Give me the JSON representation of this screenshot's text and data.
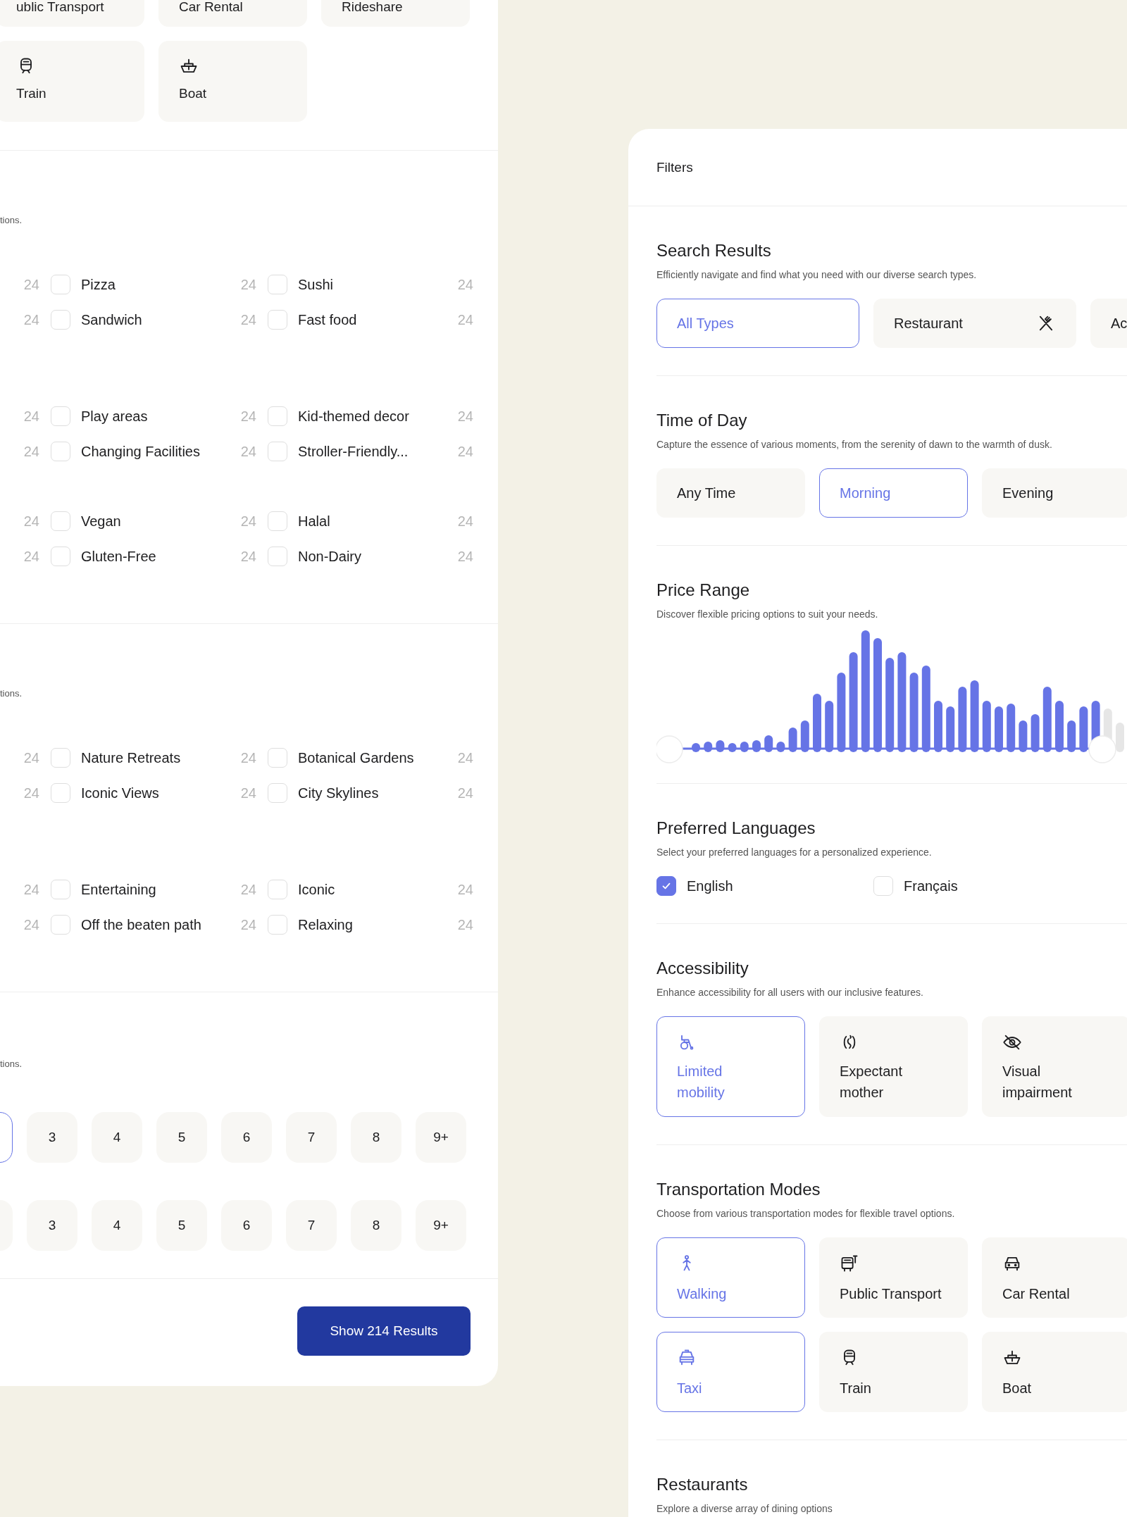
{
  "left_panel": {
    "transport_rows": [
      {
        "cards": [
          {
            "label": "ublic Transport"
          },
          {
            "label": "Car Rental"
          },
          {
            "label": "Rideshare"
          }
        ]
      },
      {
        "cards": [
          {
            "label": "Train"
          },
          {
            "label": "Boat"
          }
        ]
      }
    ],
    "option_sections": [
      {
        "description": "tions.",
        "groups": [
          {
            "rows": [
              [
                {
                  "count": "24"
                },
                {
                  "label": "Pizza",
                  "checked": false,
                  "count": "24"
                },
                {
                  "label": "Sushi",
                  "checked": false,
                  "count": "24"
                }
              ],
              [
                {
                  "count": "24"
                },
                {
                  "label": "Sandwich",
                  "checked": false,
                  "count": "24"
                },
                {
                  "label": "Fast food",
                  "checked": false,
                  "count": "24"
                }
              ]
            ]
          },
          {
            "rows": [
              [
                {
                  "count": "24"
                },
                {
                  "label": "Play areas",
                  "checked": false,
                  "count": "24"
                },
                {
                  "label": "Kid-themed decor",
                  "checked": false,
                  "count": "24"
                }
              ],
              [
                {
                  "count": "24"
                },
                {
                  "label": "Changing Facilities",
                  "checked": false,
                  "count": "24"
                },
                {
                  "label": "Stroller-Friendly...",
                  "checked": false,
                  "count": "24"
                }
              ]
            ]
          },
          {
            "rows": [
              [
                {
                  "count": "24"
                },
                {
                  "label": "Vegan",
                  "checked": false,
                  "count": "24"
                },
                {
                  "label": "Halal",
                  "checked": false,
                  "count": "24"
                }
              ],
              [
                {
                  "count": "24"
                },
                {
                  "label": "Gluten-Free",
                  "checked": false,
                  "count": "24"
                },
                {
                  "label": "Non-Dairy",
                  "checked": false,
                  "count": "24"
                }
              ]
            ]
          }
        ]
      },
      {
        "description": "tions.",
        "groups": [
          {
            "rows": [
              [
                {
                  "count": "24"
                },
                {
                  "label": "Nature Retreats",
                  "checked": false,
                  "count": "24"
                },
                {
                  "label": "Botanical Gardens",
                  "checked": false,
                  "count": "24"
                }
              ],
              [
                {
                  "count": "24"
                },
                {
                  "label": "Iconic Views",
                  "checked": false,
                  "count": "24"
                },
                {
                  "label": "City Skylines",
                  "checked": false,
                  "count": "24"
                }
              ]
            ]
          },
          {
            "rows": [
              [
                {
                  "count": "24"
                },
                {
                  "label": "Entertaining",
                  "checked": false,
                  "count": "24"
                },
                {
                  "label": "Iconic",
                  "checked": false,
                  "count": "24"
                }
              ],
              [
                {
                  "count": "24"
                },
                {
                  "label": "Off the beaten path",
                  "checked": false,
                  "count": "24"
                },
                {
                  "label": "Relaxing",
                  "checked": false,
                  "count": "24"
                }
              ]
            ]
          }
        ]
      }
    ],
    "number_section": {
      "description": "tions.",
      "rows": [
        {
          "buttons": [
            {
              "selected": true
            },
            {
              "label": "3",
              "selected": false
            },
            {
              "label": "4",
              "selected": false
            },
            {
              "label": "5",
              "selected": false
            },
            {
              "label": "6",
              "selected": false
            },
            {
              "label": "7",
              "selected": false
            },
            {
              "label": "8",
              "selected": false
            },
            {
              "label": "9+",
              "selected": false
            }
          ]
        },
        {
          "buttons": [
            {
              "selected": false
            },
            {
              "label": "3",
              "selected": false
            },
            {
              "label": "4",
              "selected": false
            },
            {
              "label": "5",
              "selected": false
            },
            {
              "label": "6",
              "selected": false
            },
            {
              "label": "7",
              "selected": false
            },
            {
              "label": "8",
              "selected": false
            },
            {
              "label": "9+",
              "selected": false
            }
          ]
        }
      ]
    },
    "show_button": "Show 214 Results"
  },
  "right_panel": {
    "title": "Filters",
    "sections": [
      {
        "kind": "choices",
        "title": "Search Results",
        "description": "Efficiently navigate and find what you need with our diverse search types.",
        "options": [
          {
            "label": "All Types",
            "selected": true
          },
          {
            "label": "Restaurant",
            "selected": false
          },
          {
            "label": "Ac",
            "selected": false
          }
        ]
      },
      {
        "kind": "choices",
        "title": "Time of Day",
        "description": "Capture the essence of various moments, from the serenity of dawn to the warmth of dusk.",
        "options": [
          {
            "label": "Any Time",
            "selected": false
          },
          {
            "label": "Morning",
            "selected": true
          },
          {
            "label": "Evening",
            "selected": false
          }
        ]
      },
      {
        "kind": "histogram",
        "title": "Price Range",
        "description": "Discover flexible pricing options to suit your needs.",
        "handles": [
          {
            "level": 0
          },
          {
            "level": 1
          }
        ]
      },
      {
        "kind": "checkboxes",
        "title": "Preferred Languages",
        "description": "Select your preferred languages for a personalized experience.",
        "options": [
          {
            "label": "English",
            "checked": true
          },
          {
            "label": "Français",
            "checked": false
          }
        ]
      },
      {
        "kind": "cards",
        "title": "Accessibility",
        "description": "Enhance accessibility for all users with our inclusive features.",
        "cards": [
          {
            "label": "Limited mobility",
            "selected": true
          },
          {
            "label": "Expectant mother",
            "selected": false
          },
          {
            "label": "Visual impairment",
            "selected": false
          }
        ]
      },
      {
        "kind": "cards",
        "title": "Transportation Modes",
        "description": "Choose from various transportation modes for flexible travel options.",
        "cards": [
          {
            "label": "Walking",
            "selected": true
          },
          {
            "label": "Public Transport",
            "selected": false
          },
          {
            "label": "Car Rental",
            "selected": false
          },
          {
            "label": "Taxi",
            "selected": true
          },
          {
            "label": "Train",
            "selected": false
          },
          {
            "label": "Boat",
            "selected": false
          }
        ]
      },
      {
        "kind": "heading",
        "title": "Restaurants",
        "description": "Explore a diverse array of dining options"
      }
    ]
  }
}
